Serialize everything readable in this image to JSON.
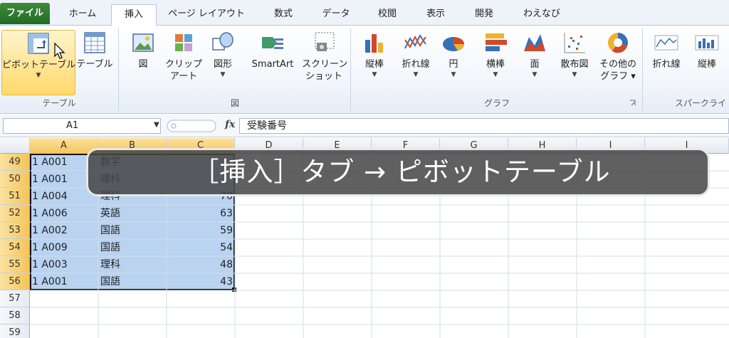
{
  "tabs": [
    "ファイル",
    "ホーム",
    "挿入",
    "ページ レイアウト",
    "数式",
    "データ",
    "校閲",
    "表示",
    "開発",
    "わえなび"
  ],
  "ribbon": {
    "pivot_label": "ピボットテーブル",
    "table_label": "テーブル",
    "group_table": "テーブル",
    "picture_label": "図",
    "clipart_label1": "クリップ",
    "clipart_label2": "アート",
    "shapes_label": "図形",
    "smartart_label": "SmartArt",
    "screenshot_label1": "スクリーン",
    "screenshot_label2": "ショット",
    "group_illust": "図",
    "col_chart": "縦棒",
    "line_chart": "折れ線",
    "pie_chart": "円",
    "bar_chart": "横棒",
    "area_chart": "面",
    "scatter_chart": "散布図",
    "other_chart1": "その他の",
    "other_chart2": "グラフ",
    "group_chart": "グラフ",
    "spark_line": "折れ線",
    "spark_col": "縦棒",
    "group_spark": "スパークライ"
  },
  "formula_bar": {
    "name_box": "A1",
    "fx": "fx",
    "formula": "受験番号"
  },
  "columns": [
    "A",
    "B",
    "C",
    "D",
    "E",
    "F",
    "G",
    "H",
    "I",
    "J"
  ],
  "rows": [
    {
      "num": "49",
      "a": "1 A001",
      "b": "数学",
      "c": ""
    },
    {
      "num": "50",
      "a": "1 A001",
      "b": "理科",
      "c": ""
    },
    {
      "num": "51",
      "a": "1 A004",
      "b": "理科",
      "c": "70"
    },
    {
      "num": "52",
      "a": "1 A006",
      "b": "英語",
      "c": "63"
    },
    {
      "num": "53",
      "a": "1 A002",
      "b": "国語",
      "c": "59"
    },
    {
      "num": "54",
      "a": "1 A009",
      "b": "国語",
      "c": "54"
    },
    {
      "num": "55",
      "a": "1 A003",
      "b": "理科",
      "c": "48"
    },
    {
      "num": "56",
      "a": "1 A001",
      "b": "国語",
      "c": "43"
    },
    {
      "num": "57",
      "a": "",
      "b": "",
      "c": ""
    },
    {
      "num": "58",
      "a": "",
      "b": "",
      "c": ""
    },
    {
      "num": "59",
      "a": "",
      "b": "",
      "c": ""
    }
  ],
  "caption": "［挿入］タブ → ピボットテーブル",
  "colors": {
    "selection_fill": "#b9d3f0",
    "file_tab": "#2a7a2c",
    "header_selected": "#f5c45a"
  }
}
